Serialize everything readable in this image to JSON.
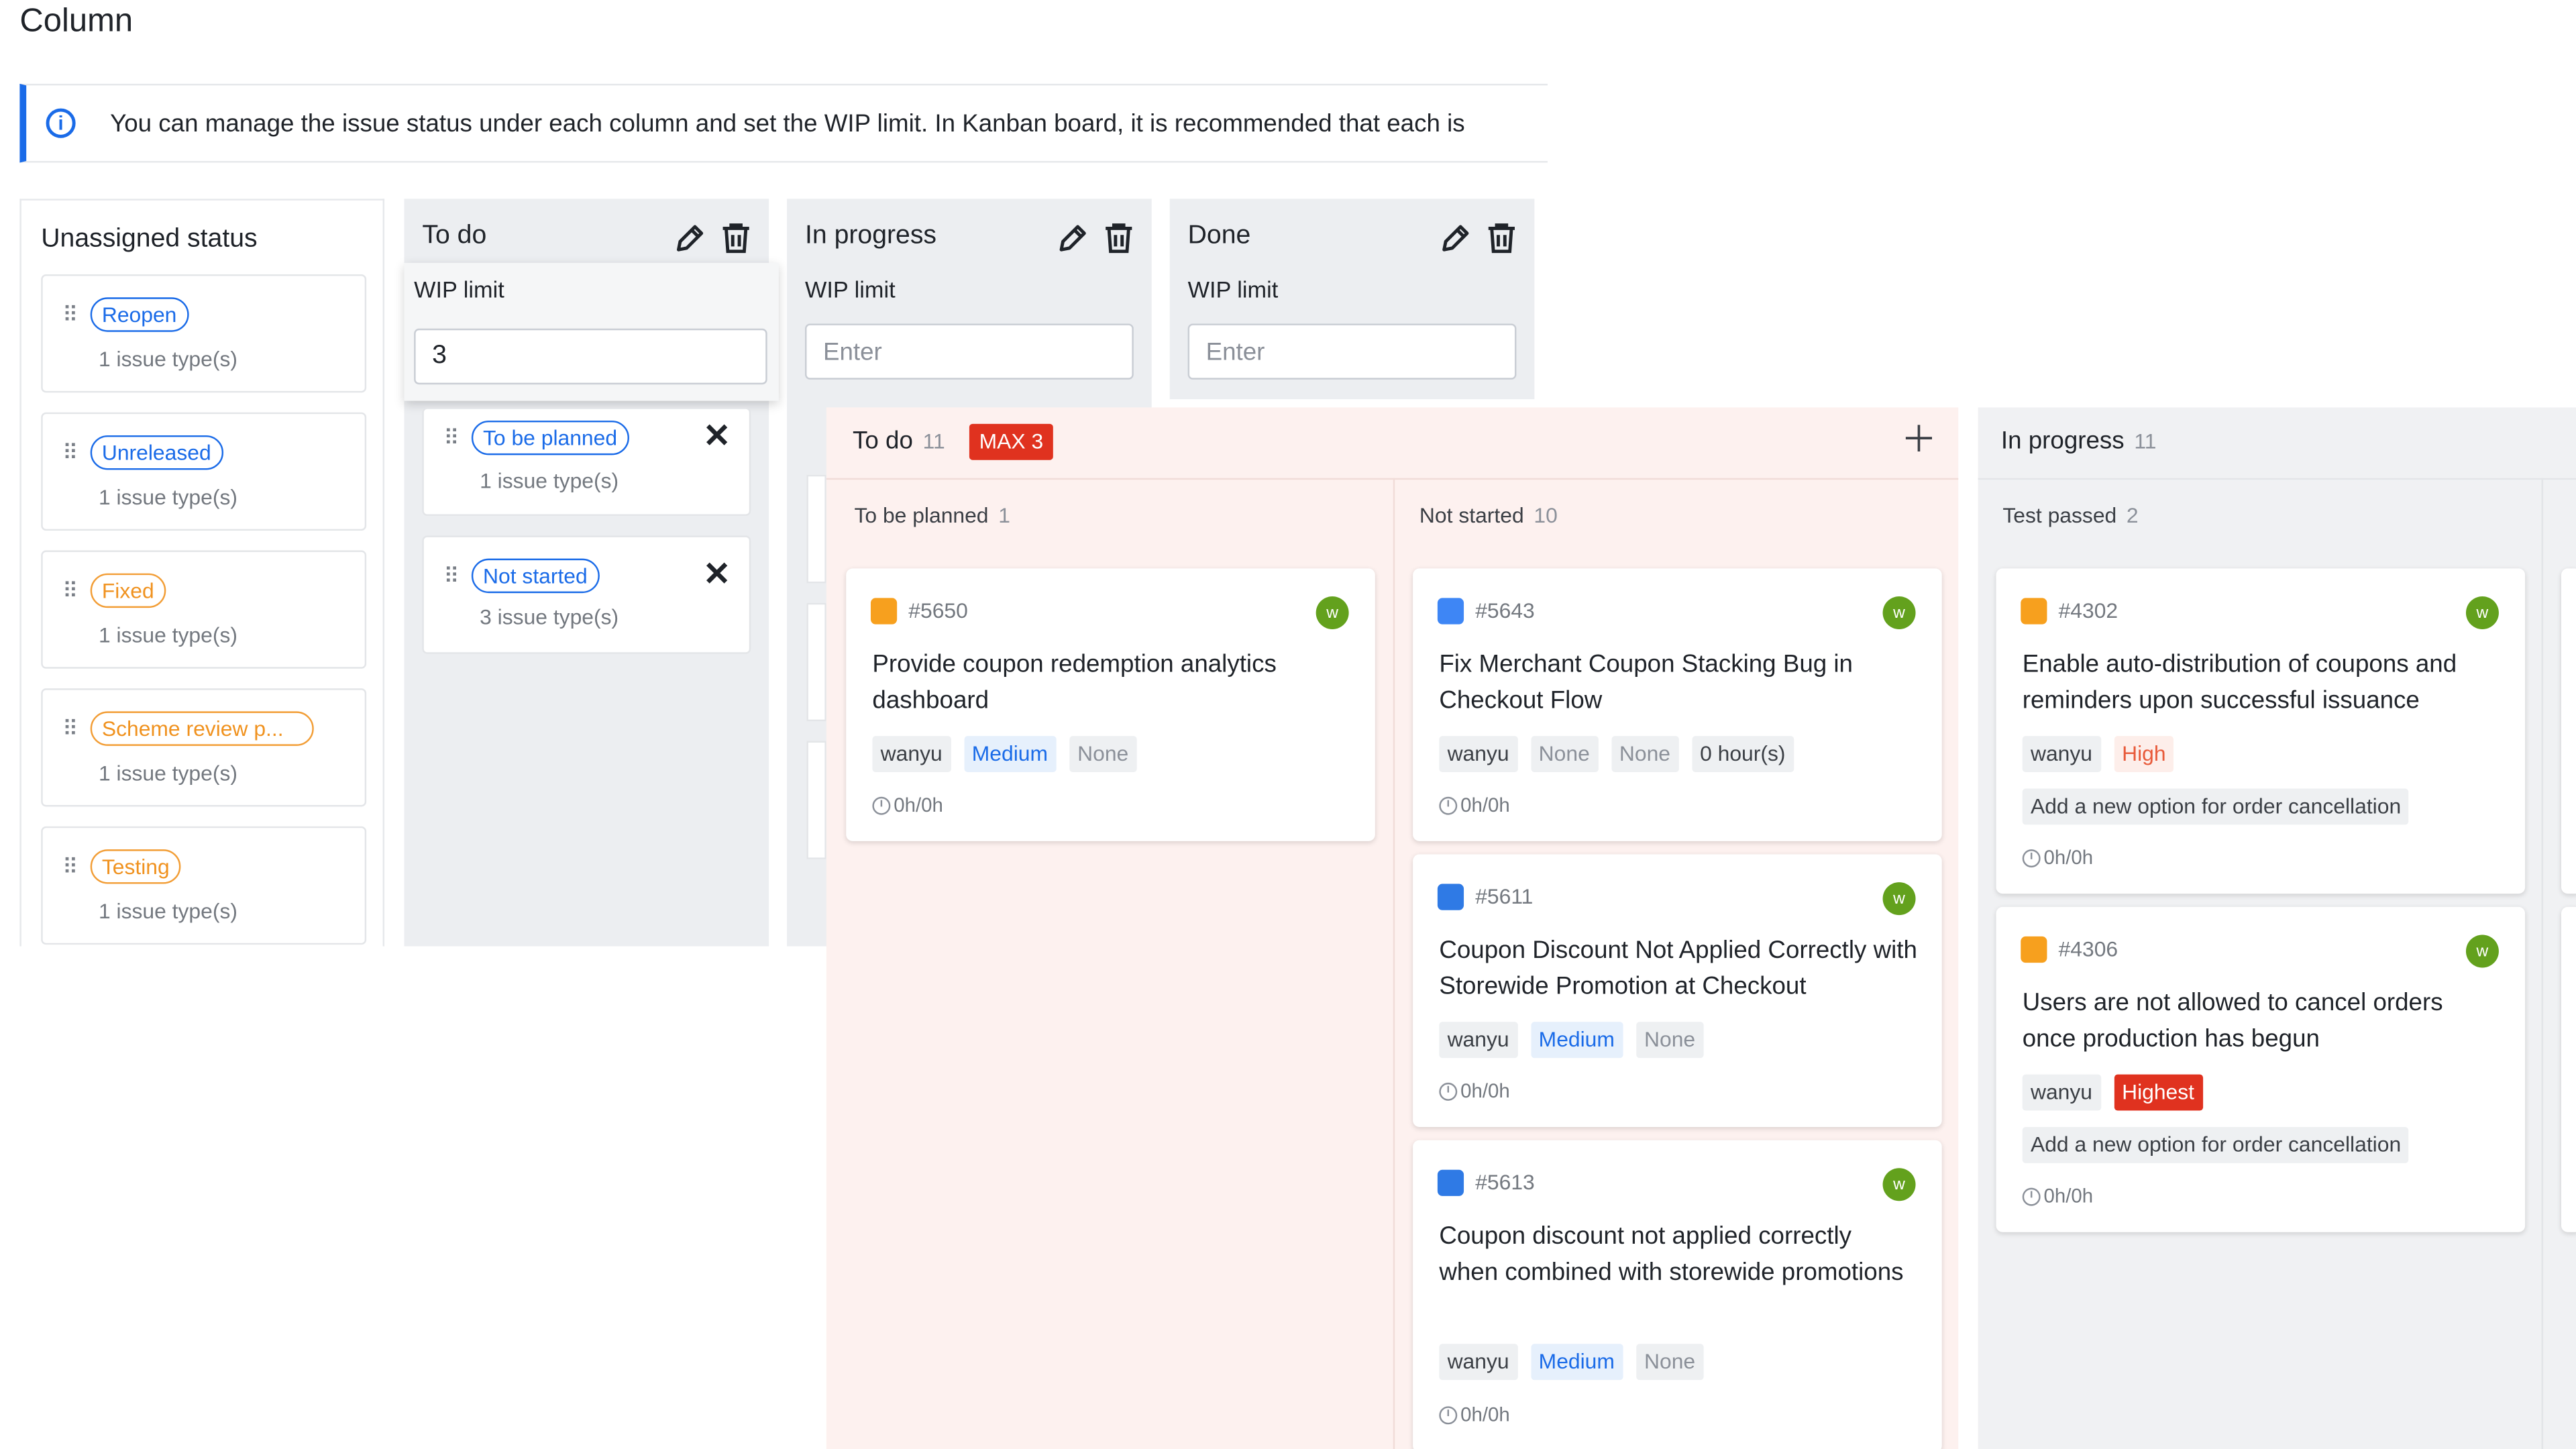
{
  "page": {
    "title": "Column"
  },
  "info": {
    "text": "You can manage the issue status under each column and set the WIP limit. In Kanban board, it is recommended that each is"
  },
  "unassigned": {
    "title": "Unassigned status",
    "items": [
      {
        "label": "Reopen",
        "types": "1 issue type(s)",
        "color": "#1a6be8"
      },
      {
        "label": "Unreleased",
        "types": "1 issue type(s)",
        "color": "#1a6be8"
      },
      {
        "label": "Fixed",
        "types": "1 issue type(s)",
        "color": "#f0921f"
      },
      {
        "label": "Scheme review p...",
        "types": "1 issue type(s)",
        "color": "#f0921f"
      },
      {
        "label": "Testing",
        "types": "1 issue type(s)",
        "color": "#f0921f"
      }
    ]
  },
  "columns": [
    {
      "title": "To do",
      "wip_label": "WIP limit",
      "wip_value": "3",
      "statuses": [
        {
          "label": "To be planned",
          "types": "1 issue type(s)"
        },
        {
          "label": "Not started",
          "types": "3 issue type(s)"
        }
      ]
    },
    {
      "title": "In progress",
      "wip_label": "WIP limit",
      "wip_placeholder": "Enter"
    },
    {
      "title": "Done",
      "wip_label": "WIP limit",
      "wip_placeholder": "Enter"
    }
  ],
  "kanban": {
    "todo": {
      "title": "To do",
      "count": "11",
      "max_badge": "MAX 3",
      "lanes": [
        {
          "title": "To be planned",
          "count": "1",
          "cards": [
            {
              "icon": "story-icon",
              "id": "#5650",
              "avatar": "w",
              "title": "Provide coupon redemption analytics dashboard",
              "tags": [
                "wanyu",
                "Medium",
                "None"
              ],
              "time": "0h/0h"
            }
          ]
        },
        {
          "title": "Not started",
          "count": "10",
          "cards": [
            {
              "icon": "task-icon",
              "id": "#5643",
              "avatar": "w",
              "title": "Fix Merchant Coupon Stacking Bug in Checkout Flow",
              "tags": [
                "wanyu",
                "None",
                "None",
                "0 hour(s)"
              ],
              "time": "0h/0h"
            },
            {
              "icon": "subtask-icon",
              "id": "#5611",
              "avatar": "w",
              "title": "Coupon Discount Not Applied Correctly with Storewide Promotion at Checkout",
              "tags": [
                "wanyu",
                "Medium",
                "None"
              ],
              "time": "0h/0h"
            },
            {
              "icon": "subtask-icon",
              "id": "#5613",
              "avatar": "w",
              "title": "Coupon discount not applied correctly when combined with storewide promotions",
              "tags": [
                "wanyu",
                "Medium",
                "None"
              ],
              "time": "0h/0h"
            }
          ]
        }
      ]
    },
    "inprogress": {
      "title": "In progress",
      "count": "11",
      "lanes": [
        {
          "title": "Test passed",
          "count": "2",
          "cards": [
            {
              "icon": "story-icon",
              "id": "#4302",
              "avatar": "w",
              "title": "Enable auto-distribution of coupons and reminders upon successful issuance",
              "tags": [
                "wanyu",
                "High"
              ],
              "extra_tag": "Add a new option for order cancellation",
              "time": "0h/0h"
            },
            {
              "icon": "story-icon",
              "id": "#4306",
              "avatar": "w",
              "title": "Users are not allowed to cancel orders once production has begun",
              "tags": [
                "wanyu",
                "Highest"
              ],
              "extra_tag": "Add a new option for order cancellation",
              "time": "0h/0h"
            }
          ]
        }
      ]
    }
  }
}
